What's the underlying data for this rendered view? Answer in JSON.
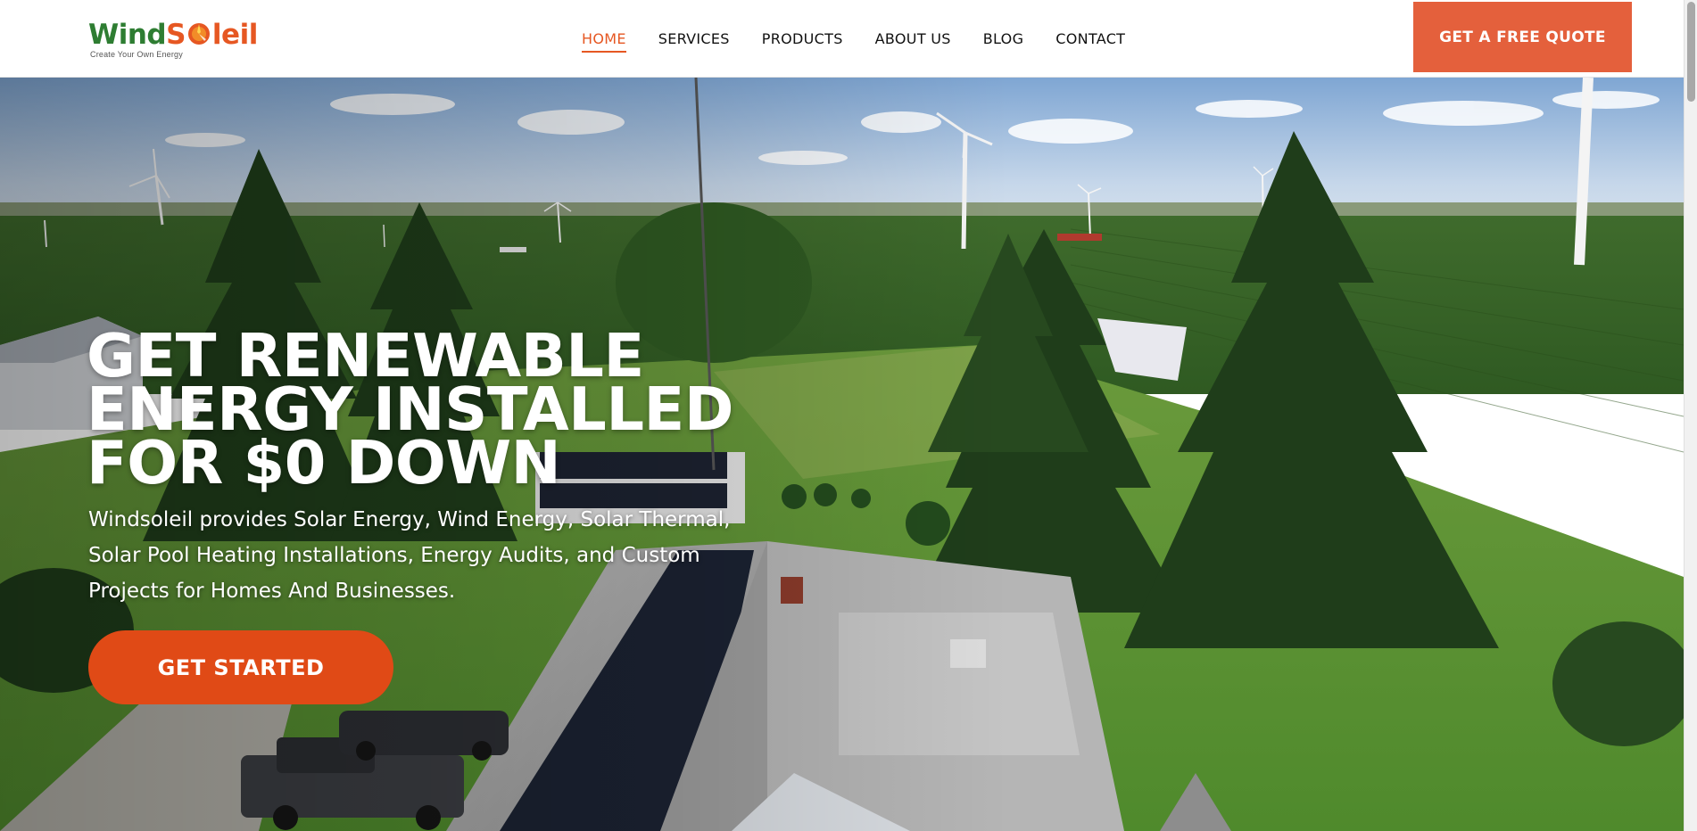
{
  "brand": {
    "name_part1": "Wind",
    "name_part2": "S",
    "name_part3": "leil",
    "tagline": "Create Your Own Energy",
    "colors": {
      "green": "#2e7d32",
      "orange": "#e65722"
    }
  },
  "nav": {
    "items": [
      {
        "label": "HOME",
        "active": true
      },
      {
        "label": "SERVICES",
        "active": false
      },
      {
        "label": "PRODUCTS",
        "active": false
      },
      {
        "label": "ABOUT US",
        "active": false
      },
      {
        "label": "BLOG",
        "active": false
      },
      {
        "label": "CONTACT",
        "active": false
      }
    ],
    "active_color": "#e65722"
  },
  "header": {
    "quote_button": "GET A FREE QUOTE",
    "quote_button_color": "#e4603c"
  },
  "hero": {
    "title_lines": [
      "GET RENEWABLE",
      "ENERGY INSTALLED",
      "FOR $0 DOWN"
    ],
    "description_lines": [
      "Windsoleil provides Solar Energy, Wind Energy, Solar Thermal,",
      "Solar Pool Heating Installations, Energy Audits, and Custom",
      "Projects for Homes And Businesses."
    ],
    "cta_label": "GET STARTED",
    "cta_color": "#e04a16",
    "background_image": "aerial-farmhouse-solar-wind-turbines"
  }
}
